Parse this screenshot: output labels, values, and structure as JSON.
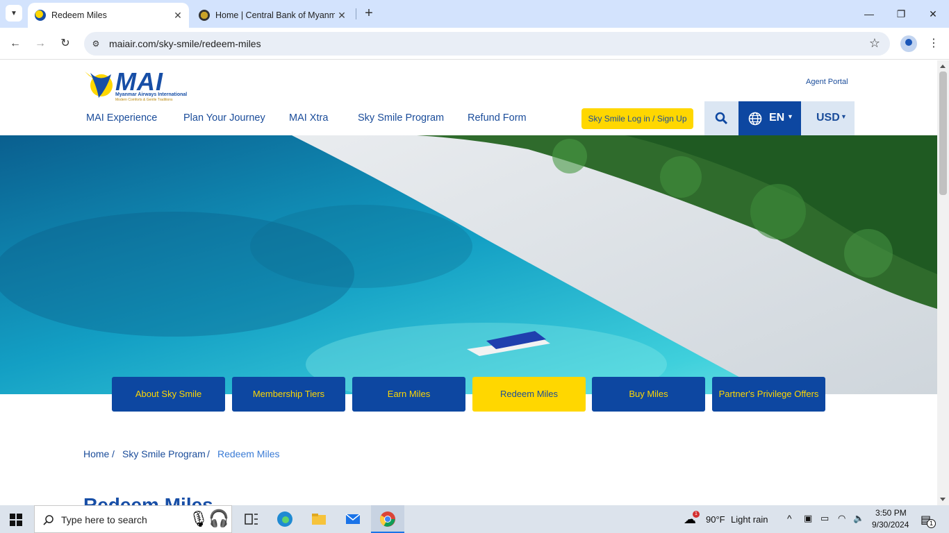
{
  "browser": {
    "tabs": [
      {
        "title": "Redeem Miles",
        "active": true
      },
      {
        "title": "Home | Central Bank of Myanmar",
        "active": false
      }
    ],
    "url": "maiair.com/sky-smile/redeem-miles",
    "icons": {
      "tab_search": "chevron-down-icon",
      "close": "close-icon",
      "new_tab": "plus-icon",
      "back": "back-arrow-icon",
      "forward": "forward-arrow-icon",
      "reload": "reload-icon",
      "site_info": "site-info-icon",
      "bookmark": "star-icon",
      "profile": "profile-icon",
      "menu": "kebab-menu-icon"
    }
  },
  "site": {
    "logo": {
      "name": "MAI",
      "subtitle": "Myanmar Airways International",
      "tagline": "Modern Comforts & Gentle Traditions"
    },
    "agent_portal": "Agent Portal",
    "nav": [
      "MAI Experience",
      "Plan Your Journey",
      "MAI Xtra",
      "Sky Smile Program",
      "Refund Form"
    ],
    "login_label": "Sky Smile Log in / Sign Up",
    "language": "EN",
    "currency": "USD",
    "subnav": [
      {
        "label": "About Sky Smile",
        "active": false
      },
      {
        "label": "Membership Tiers",
        "active": false
      },
      {
        "label": "Earn Miles",
        "active": false
      },
      {
        "label": "Redeem Miles",
        "active": true
      },
      {
        "label": "Buy Miles",
        "active": false
      },
      {
        "label": "Partner's Privilege Offers",
        "active": false
      }
    ],
    "breadcrumb": [
      "Home",
      "Sky Smile Program",
      "Redeem Miles"
    ],
    "breadcrumb_sep": "/",
    "heading": "Redeem Miles",
    "colors": {
      "brand_blue": "#0d47a1",
      "brand_yellow": "#ffd700",
      "link_blue": "#1a4c9a"
    }
  },
  "taskbar": {
    "search_placeholder": "Type here to search",
    "weather": {
      "temp": "90°F",
      "condition": "Light rain",
      "badge": "1"
    },
    "time": "3:50 PM",
    "date": "9/30/2024",
    "notification_count": "1"
  }
}
